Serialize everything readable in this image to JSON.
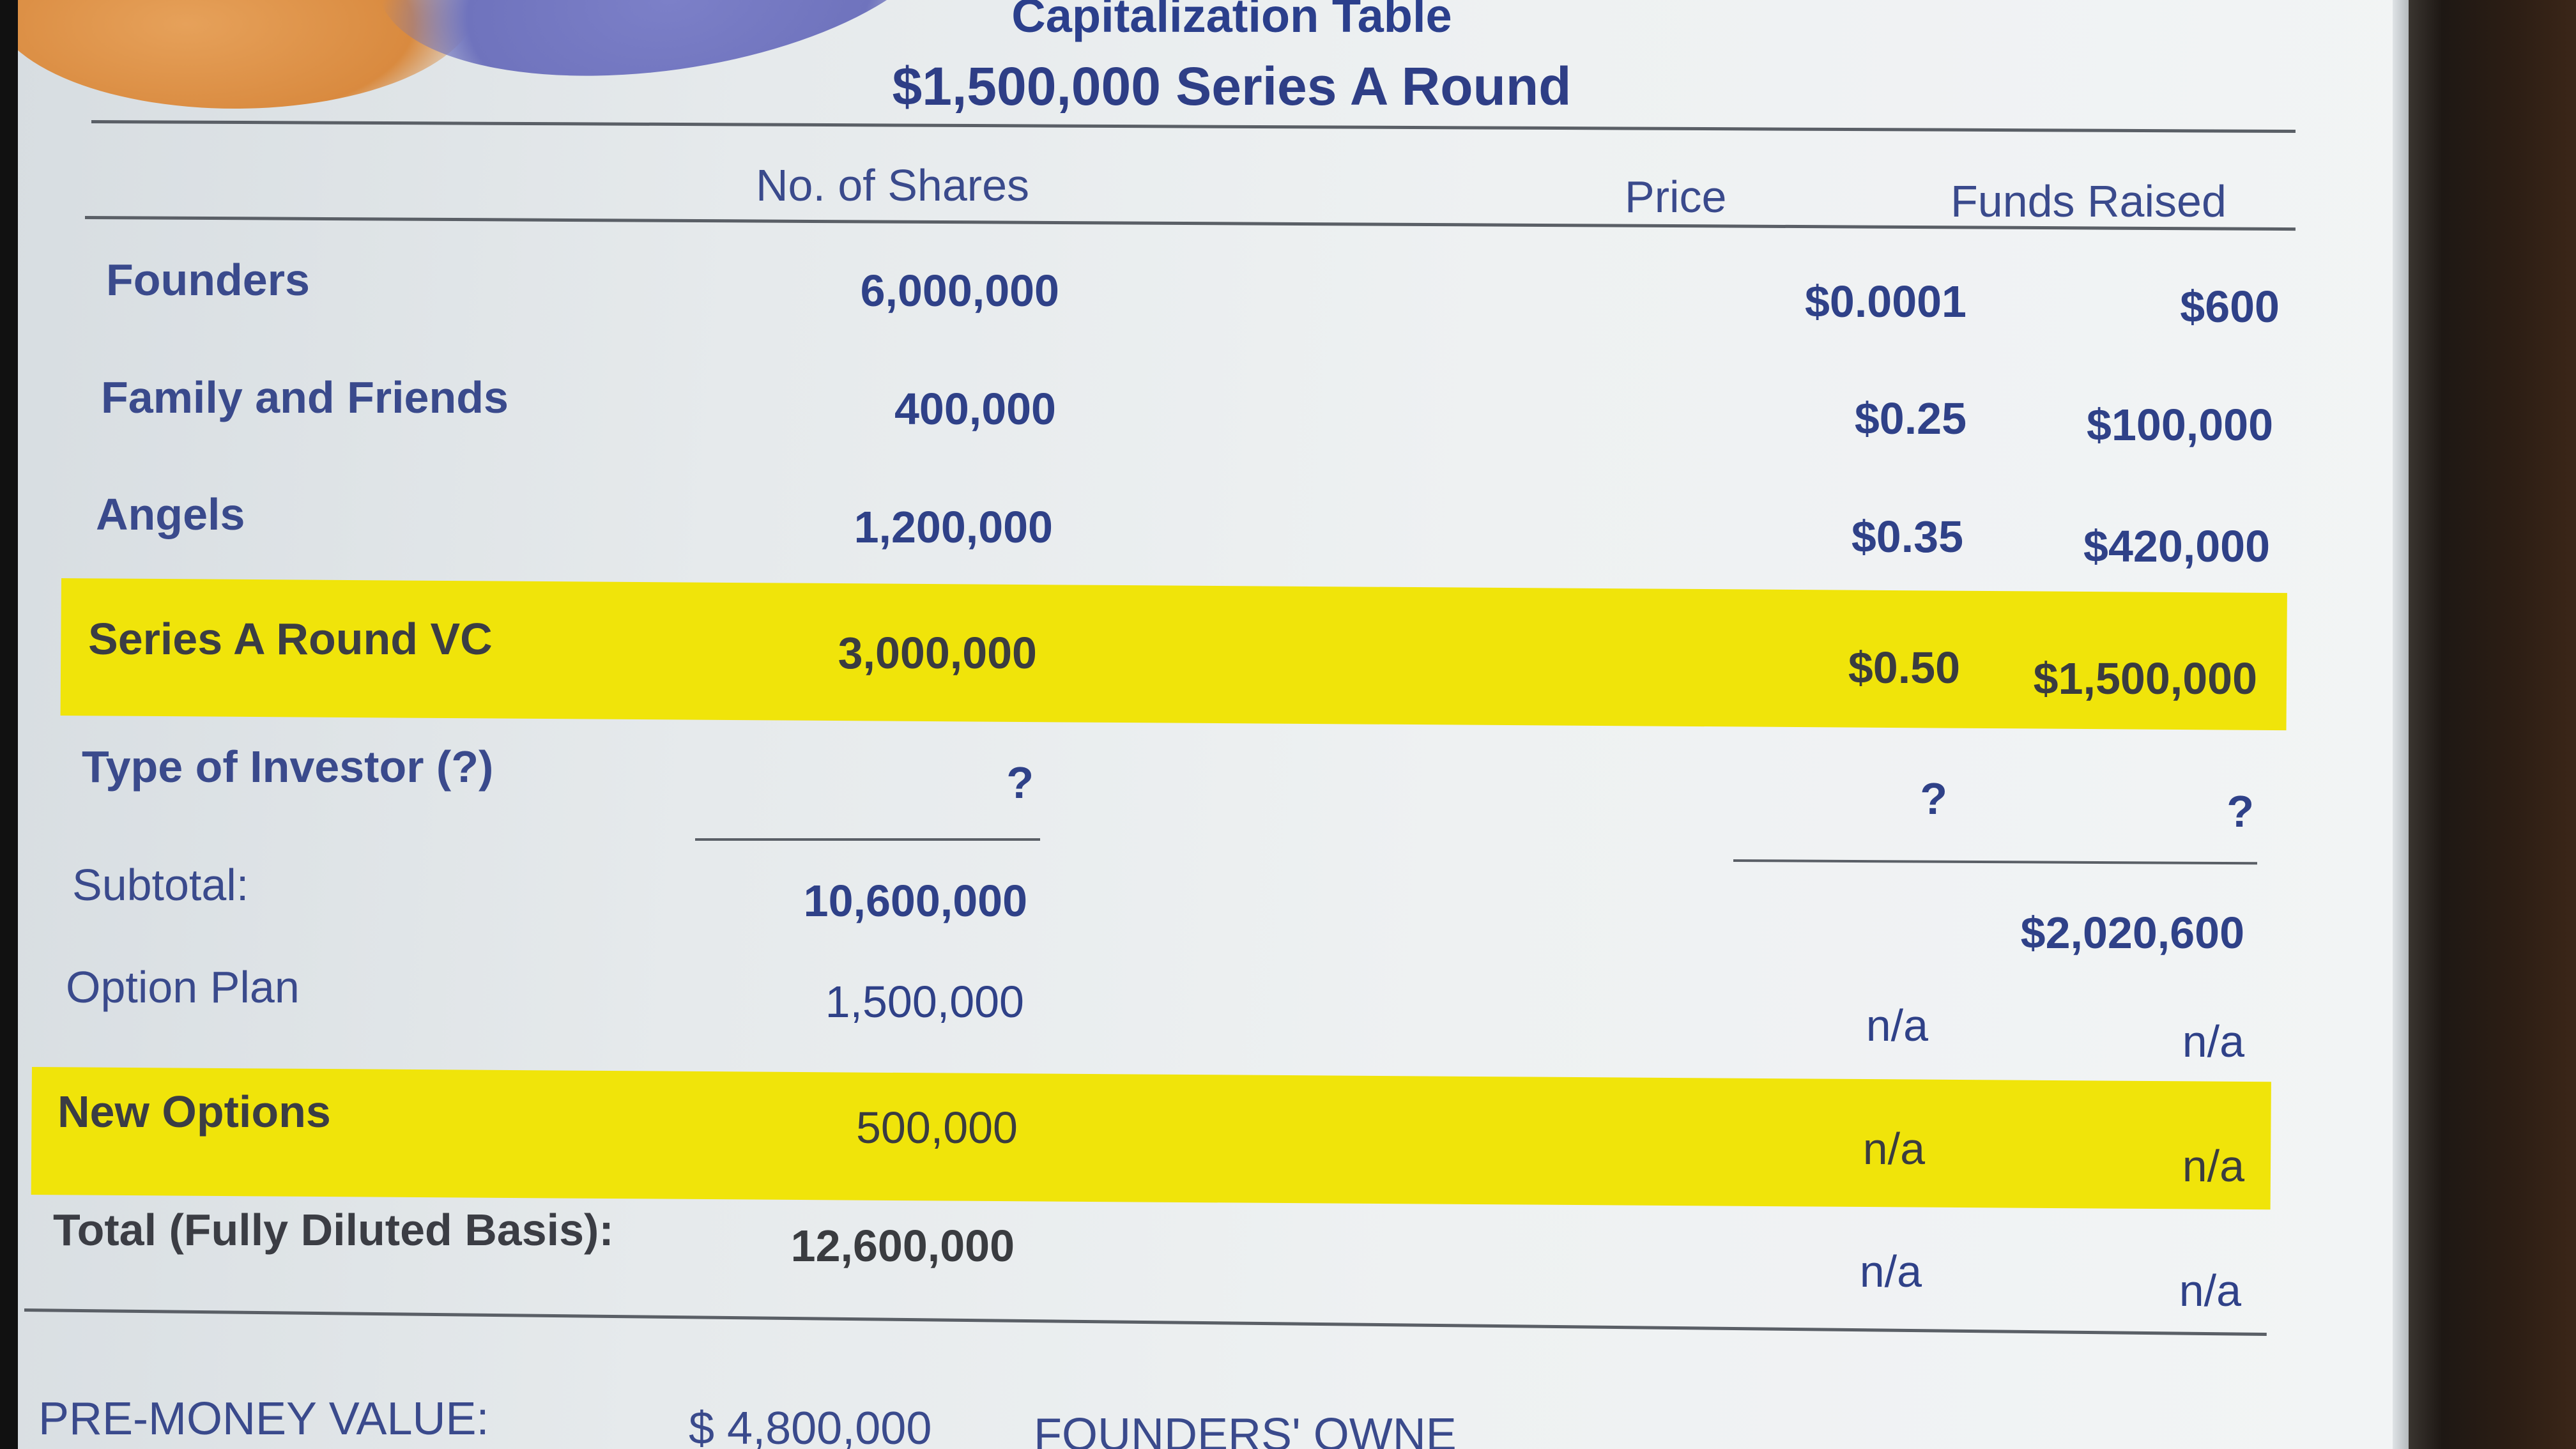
{
  "slide": {
    "title": "Capitalization Table",
    "subtitle": "$1,500,000 Series A Round"
  },
  "columns": {
    "shares": "No. of Shares",
    "price": "Price",
    "funds": "Funds Raised"
  },
  "rows": [
    {
      "label": "Founders",
      "shares": "6,000,000",
      "price": "$0.0001",
      "funds": "$600"
    },
    {
      "label": "Family and Friends",
      "shares": "400,000",
      "price": "$0.25",
      "funds": "$100,000"
    },
    {
      "label": "Angels",
      "shares": "1,200,000",
      "price": "$0.35",
      "funds": "$420,000"
    },
    {
      "label": "Series A Round VC",
      "shares": "3,000,000",
      "price": "$0.50",
      "funds": "$1,500,000",
      "highlight": true
    },
    {
      "label": "Type of Investor (?)",
      "shares": "?",
      "price": "?",
      "funds": "?"
    },
    {
      "label": "Subtotal:",
      "shares": "10,600,000",
      "price": "",
      "funds": "$2,020,600"
    },
    {
      "label": "Option Plan",
      "shares": "1,500,000",
      "price": "n/a",
      "funds": "n/a"
    },
    {
      "label": "New Options",
      "shares": "500,000",
      "price": "n/a",
      "funds": "n/a",
      "highlight": true
    },
    {
      "label": "Total (Fully Diluted Basis):",
      "shares": "12,600,000",
      "price": "n/a",
      "funds": "n/a"
    }
  ],
  "footer": {
    "pre_money_label": "PRE-MONEY VALUE:",
    "pre_money_value": "$ 4,800,000",
    "founders_label": "FOUNDERS' OWNE"
  },
  "colors": {
    "highlight": "#f0e40a",
    "text": "#2f4188",
    "rule": "#5a5f66"
  }
}
